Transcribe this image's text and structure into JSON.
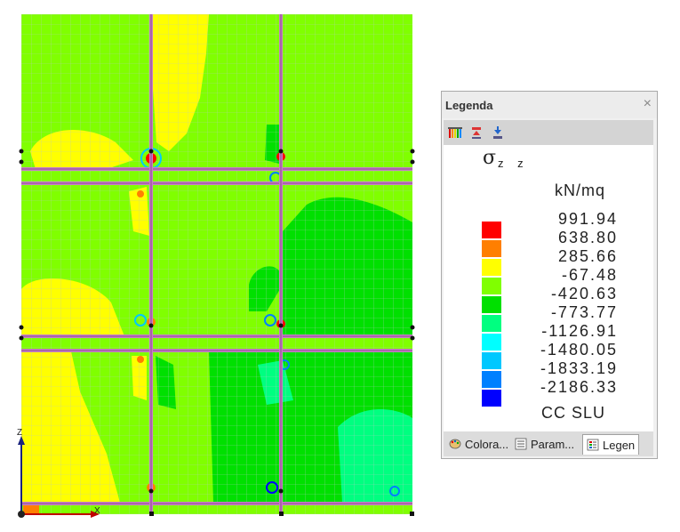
{
  "legend": {
    "title": "Legenda",
    "close_glyph": "×",
    "symbol": "σ",
    "symbol_subscript": "z z",
    "unit": "kN/mq",
    "combo": "CC  SLU",
    "entries": [
      {
        "value": "991.94",
        "color": "#ff0000"
      },
      {
        "value": "638.80",
        "color": "#ff7f00"
      },
      {
        "value": "285.66",
        "color": "#ffff00"
      },
      {
        "value": "-67.48",
        "color": "#80ff00"
      },
      {
        "value": "-420.63",
        "color": "#00e000"
      },
      {
        "value": "-773.77",
        "color": "#00ff80"
      },
      {
        "value": "-1126.91",
        "color": "#00ffff"
      },
      {
        "value": "-1480.05",
        "color": "#00c8ff"
      },
      {
        "value": "-1833.19",
        "color": "#0080ff"
      },
      {
        "value": "-2186.33",
        "color": "#0000ff"
      }
    ],
    "toolbar_icons": [
      "color-scale-icon",
      "upload-icon",
      "download-icon"
    ],
    "tabs": [
      {
        "label": "Colora...",
        "icon": "palette-icon",
        "active": false
      },
      {
        "label": "Param...",
        "icon": "parameters-icon",
        "active": false
      },
      {
        "label": "Legen",
        "icon": "legend-icon",
        "active": true
      }
    ]
  },
  "axes": {
    "z_label": "Z",
    "x_label": "X"
  }
}
